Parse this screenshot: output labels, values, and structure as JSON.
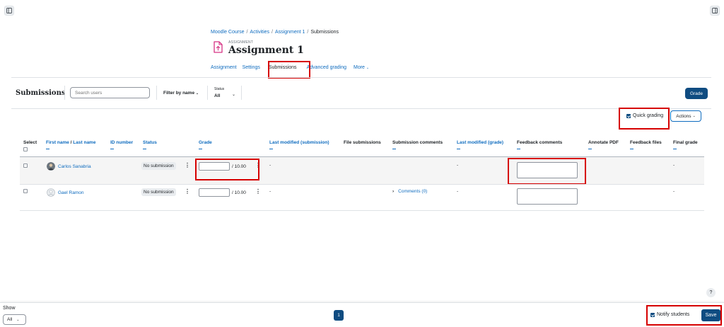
{
  "breadcrumb": [
    "Moodle Course",
    "Activities",
    "Assignment 1",
    "Submissions"
  ],
  "activity": {
    "type_label": "ASSIGNMENT",
    "title": "Assignment 1"
  },
  "tabs": [
    {
      "label": "Assignment"
    },
    {
      "label": "Settings"
    },
    {
      "label": "Submissions"
    },
    {
      "label": "Advanced grading"
    },
    {
      "label": "More"
    }
  ],
  "toolbar": {
    "title": "Submissions",
    "search_placeholder": "Search users",
    "filter_label": "Filter by name",
    "status_label": "Status",
    "status_value": "All",
    "grade_button": "Grade",
    "quick_grading": "Quick grading",
    "actions_button": "Actions"
  },
  "table": {
    "headers": [
      "Select",
      "First name / Last name",
      "ID number",
      "Status",
      "Grade",
      "Last modified (submission)",
      "File submissions",
      "Submission comments",
      "Last modified (grade)",
      "Feedback comments",
      "Annotate PDF",
      "Feedback files",
      "Final grade"
    ],
    "first_name_label": "First name",
    "last_name_label": "Last name",
    "rows": [
      {
        "name": "Carlos Sanabria",
        "status": "No submission",
        "grade_out_of": "/ 10.00",
        "last_modified_submission": "-",
        "submission_comments": "",
        "last_modified_grade": "-",
        "final_grade": "-"
      },
      {
        "name": "Gael Ramon",
        "status": "No submission",
        "grade_out_of": "/ 10.00",
        "last_modified_submission": "-",
        "submission_comments": "Comments (0)",
        "last_modified_grade": "-",
        "final_grade": "-"
      }
    ]
  },
  "footer": {
    "show_label": "Show",
    "show_value": "All",
    "page": "1",
    "notify_students": "Notify students",
    "save": "Save",
    "help": "?"
  },
  "colors": {
    "brand": "#0f4c81",
    "link": "#0f6cbf",
    "highlight": "#d60000"
  }
}
